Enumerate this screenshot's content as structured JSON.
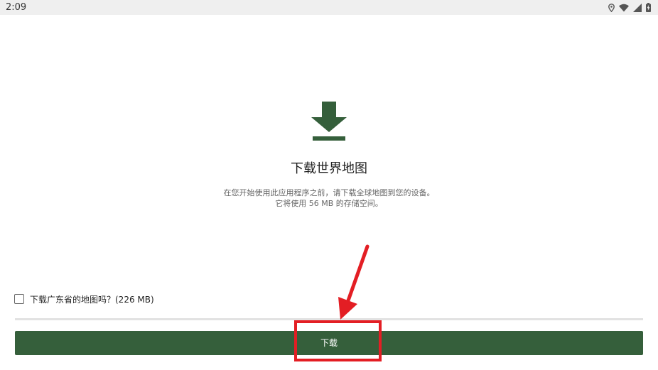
{
  "status_bar": {
    "time": "2:09",
    "icons": [
      "location-icon",
      "wifi-icon",
      "signal-icon",
      "battery-icon"
    ]
  },
  "main": {
    "icon": "download-icon",
    "title": "下载世界地图",
    "description_line1": "在您开始使用此应用程序之前，请下载全球地图到您的设备。",
    "description_line2": "它将使用 56 MB 的存储空间。"
  },
  "option": {
    "checkbox_label": "下载广东省的地图吗？(226 MB)",
    "checked": false
  },
  "action": {
    "download_label": "下载"
  },
  "colors": {
    "accent": "#355f3b",
    "annotation": "#e31e24"
  }
}
